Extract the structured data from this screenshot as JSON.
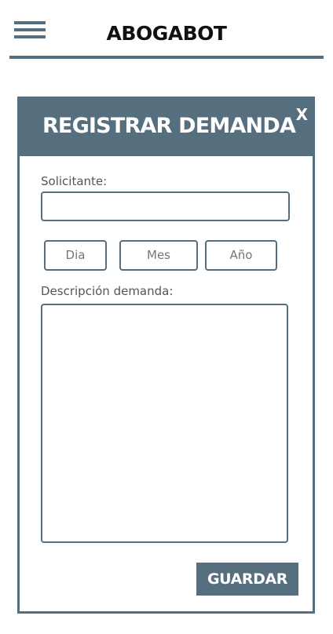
{
  "header": {
    "title": "ABOGABOT",
    "menu_icon": "hamburger-menu-icon"
  },
  "modal": {
    "title": "REGISTRAR DEMANDA",
    "close_label": "X",
    "fields": {
      "solicitante_label": "Solicitante:",
      "solicitante_value": "",
      "dia_placeholder": "Dia",
      "mes_placeholder": "Mes",
      "anio_placeholder": "Año",
      "descripcion_label": "Descripción demanda:",
      "descripcion_value": ""
    },
    "save_label": "GUARDAR"
  },
  "colors": {
    "accent": "#556f7e",
    "text": "#111111",
    "label": "#555555",
    "background": "#ffffff"
  }
}
